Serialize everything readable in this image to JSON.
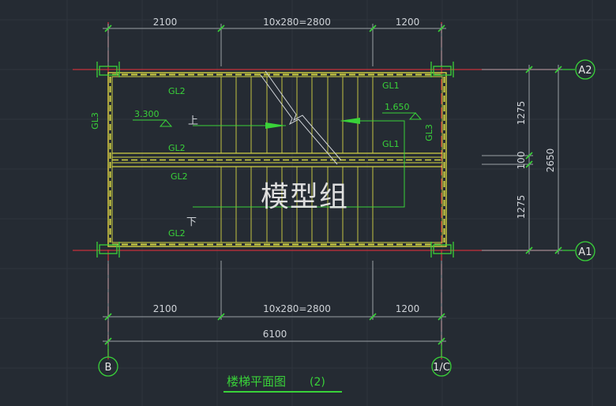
{
  "drawing": {
    "title": "楼梯平面图",
    "title_number": "(2)",
    "watermark": "模型组"
  },
  "dimensions": {
    "top": [
      "2100",
      "10x280=2800",
      "1200"
    ],
    "bottom": [
      "2100",
      "10x280=2800",
      "1200"
    ],
    "total": "6100",
    "right": [
      "1275",
      "100",
      "1275"
    ],
    "right_total": "2650"
  },
  "axes": {
    "top_right": "A2",
    "bottom_right": "A1",
    "bottom_left": "B",
    "bottom_mid": "1/C"
  },
  "labels": {
    "gl2_top": "GL2",
    "gl2_mid_upper": "GL2",
    "gl2_mid_lower": "GL2",
    "gl2_bottom": "GL2",
    "gl1_top": "GL1",
    "gl1_mid": "GL1",
    "gl3_left": "GL3",
    "gl3_right": "GL3",
    "elev_left": "3.300",
    "elev_right": "1.650",
    "up": "上",
    "down": "下"
  },
  "colors": {
    "background": "#252b33",
    "structure": "#d4d443",
    "text_green": "#39d239",
    "axis_red": "#c8303a",
    "dimension": "#9aa0a6"
  }
}
